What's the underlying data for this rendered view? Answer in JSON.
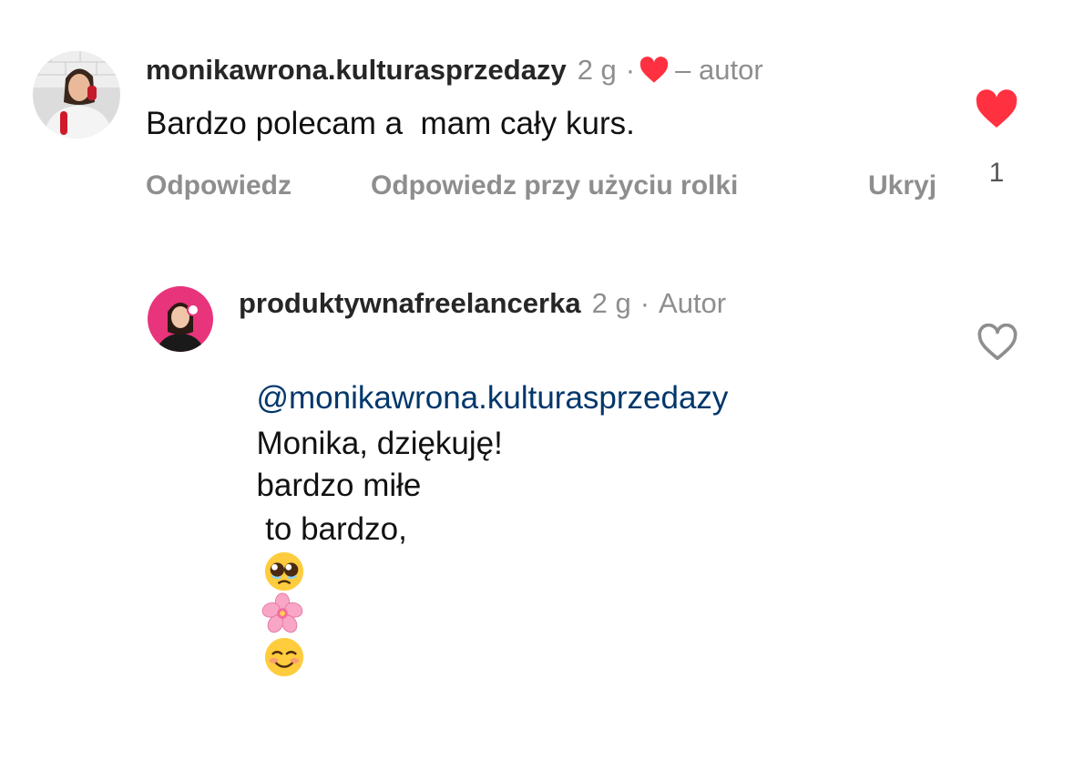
{
  "comment": {
    "username": "monikawrona.kulturasprzedazy",
    "time": "2 g",
    "separator": "·",
    "author_label": "– autor",
    "text": "Bardzo polecam a  mam cały kurs.",
    "actions": {
      "reply": "Odpowiedz",
      "reply_reel": "Odpowiedz przy użyciu rolki",
      "hide": "Ukryj"
    },
    "like_count": "1",
    "liked": true,
    "liked_by_author_icon": "heart-icon"
  },
  "reply": {
    "username": "produktywnafreelancerka",
    "time": "2 g",
    "separator": "·",
    "author_label": "Autor",
    "mention": "@monikawrona.kulturasprzedazy",
    "line1_text": "Monika, dziękuję!",
    "line1_emoji": "pleading-face-emoji",
    "line1_suffix": " to bardzo,",
    "line2_text": "bardzo miłe",
    "line2_emojis": [
      "cherry-blossom-emoji",
      "smiling-face-emoji"
    ],
    "liked": false
  },
  "colors": {
    "heart_red": "#ff3040",
    "meta_gray": "#8e8e8e",
    "mention_blue": "#00376b",
    "avatar_ring_pink": "#e8347a"
  }
}
